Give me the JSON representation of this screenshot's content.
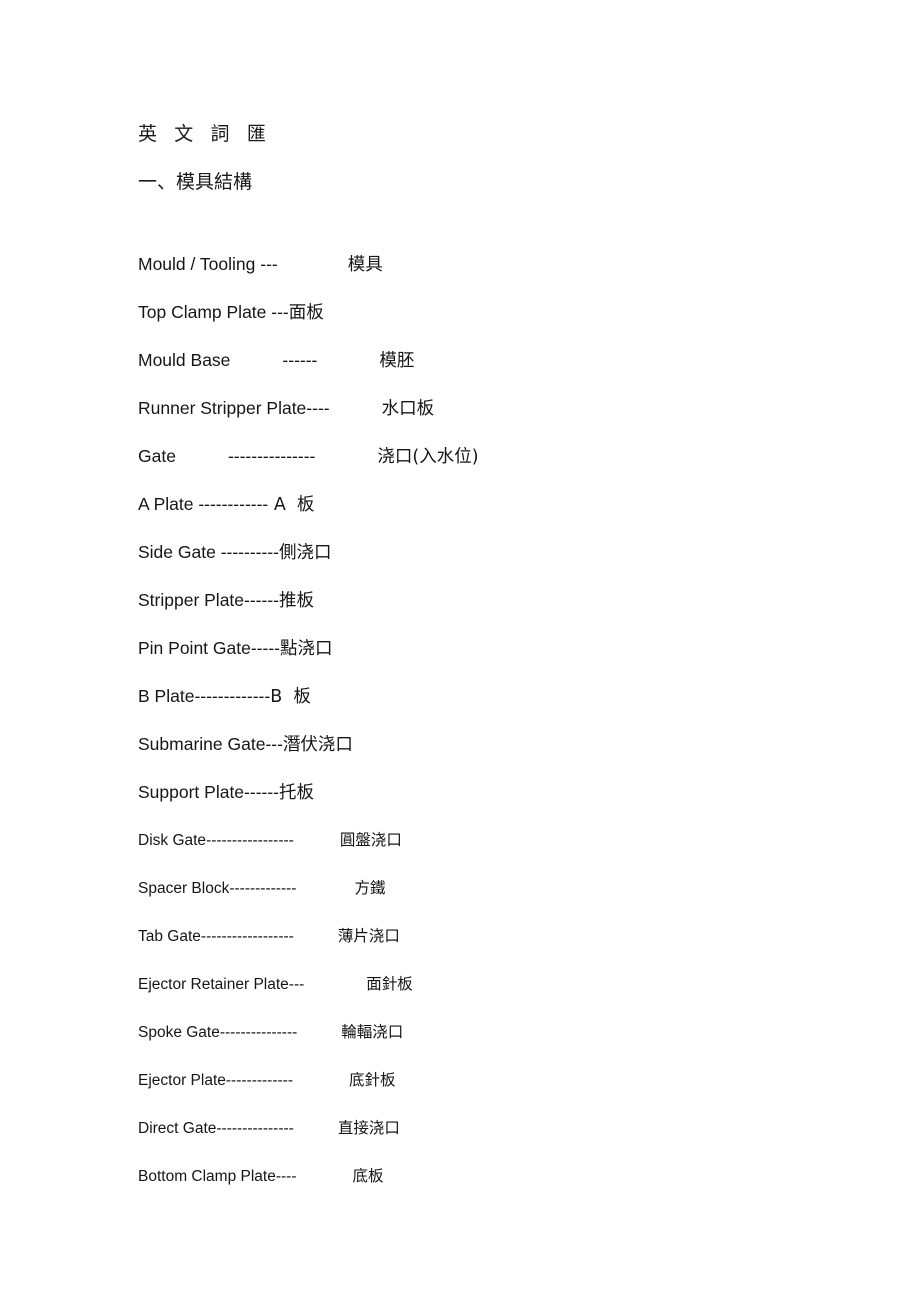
{
  "document": {
    "title": "英 文 詞 匯",
    "section_heading": "一、模具結構"
  },
  "entries": [
    {
      "term": "Mould / Tooling ",
      "dashes": "---",
      "cn": "模具",
      "gap": 70,
      "size": "lg"
    },
    {
      "term": "Top Clamp Plate ",
      "dashes": "---",
      "cn": "面板",
      "gap": 0,
      "size": "lg"
    },
    {
      "term": "Mould Base",
      "dashes": "------",
      "cn": "模胚",
      "gap": 62,
      "size": "lg",
      "dash_gap": true
    },
    {
      "term": "Runner Stripper Plate",
      "dashes": "----",
      "cn": "水口板",
      "gap": 52,
      "size": "lg"
    },
    {
      "term": "Gate",
      "dashes": "---------------",
      "cn": "浇口(入水位)",
      "gap": 62,
      "size": "lg",
      "dash_gap": true
    },
    {
      "term": "A Plate ",
      "dashes": "------------",
      "cn": " A  板",
      "gap": 0,
      "size": "lg"
    },
    {
      "term": "Side Gate ",
      "dashes": "----------",
      "cn": "側浇口",
      "gap": 0,
      "size": "lg"
    },
    {
      "term": "Stripper Plate",
      "dashes": "------",
      "cn": "推板",
      "gap": 0,
      "size": "lg"
    },
    {
      "term": "Pin Point Gate",
      "dashes": "-----",
      "cn": "點浇口",
      "gap": 0,
      "size": "lg"
    },
    {
      "term": "B Plate",
      "dashes": "-------------",
      "cn": "B  板",
      "gap": 0,
      "size": "lg"
    },
    {
      "term": "Submarine Gate",
      "dashes": "---",
      "cn": "潛伏浇口",
      "gap": 0,
      "size": "lg"
    },
    {
      "term": "Support Plate",
      "dashes": "------",
      "cn": "托板",
      "gap": 0,
      "size": "lg"
    },
    {
      "term": "Disk Gate",
      "dashes": "-----------------",
      "cn": "圓盤浇口",
      "gap": 46,
      "size": "sm"
    },
    {
      "term": "Spacer Block",
      "dashes": "-------------",
      "cn": "方鐵",
      "gap": 58,
      "size": "sm"
    },
    {
      "term": "Tab Gate",
      "dashes": "------------------",
      "cn": "薄片浇口",
      "gap": 44,
      "size": "sm"
    },
    {
      "term": "Ejector Retainer Plate",
      "dashes": "---",
      "cn": "面針板",
      "gap": 62,
      "size": "sm"
    },
    {
      "term": "Spoke Gate",
      "dashes": "---------------",
      "cn": "輪輻浇口",
      "gap": 44,
      "size": "sm"
    },
    {
      "term": "Ejector Plate",
      "dashes": "-------------",
      "cn": "底針板",
      "gap": 56,
      "size": "sm"
    },
    {
      "term": "Direct Gate",
      "dashes": "---------------",
      "cn": "直接浇口",
      "gap": 44,
      "size": "sm"
    },
    {
      "term": "Bottom Clamp Plate",
      "dashes": "----",
      "cn": "底板",
      "gap": 56,
      "size": "sm"
    }
  ],
  "colors": {
    "page_background": "#ffffff",
    "text": "#161616"
  }
}
